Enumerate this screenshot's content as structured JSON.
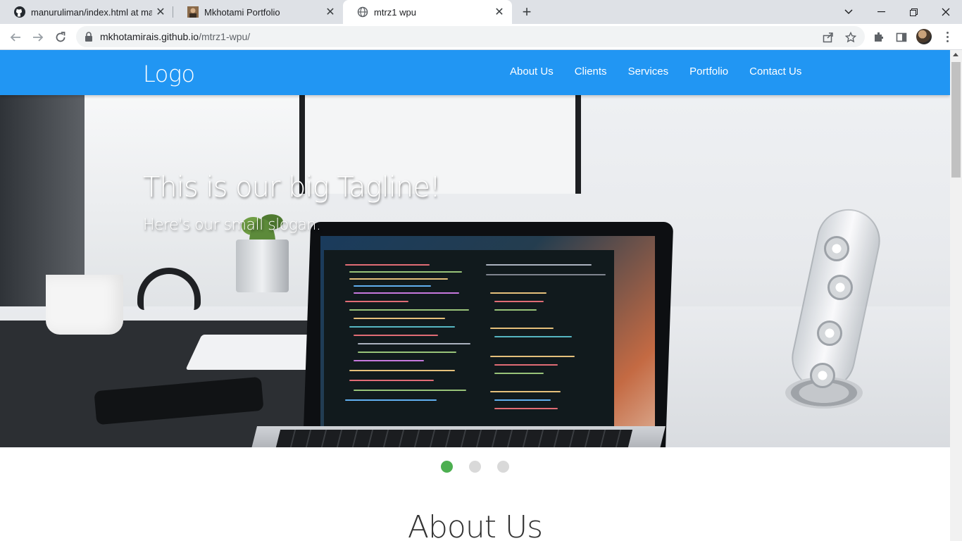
{
  "browser": {
    "tabs": [
      {
        "title": "manuruliman/index.html at main",
        "icon": "github-icon"
      },
      {
        "title": "Mkhotami Portfolio",
        "icon": "profile-photo-icon"
      },
      {
        "title": "mtrz1 wpu",
        "icon": "globe-icon"
      }
    ],
    "url": {
      "host": "mkhotamirais.github.io",
      "path": "/mtrz1-wpu/"
    }
  },
  "site": {
    "logo": "Logo",
    "nav": [
      "About Us",
      "Clients",
      "Services",
      "Portfolio",
      "Contact Us"
    ],
    "nav_color": "#2196f3",
    "hero": {
      "tagline": "This is our big Tagline!",
      "slogan": "Here's our small slogan."
    },
    "slider": {
      "count": 3,
      "active_index": 0,
      "active_color": "#4caf50"
    },
    "section_title": "About Us"
  }
}
